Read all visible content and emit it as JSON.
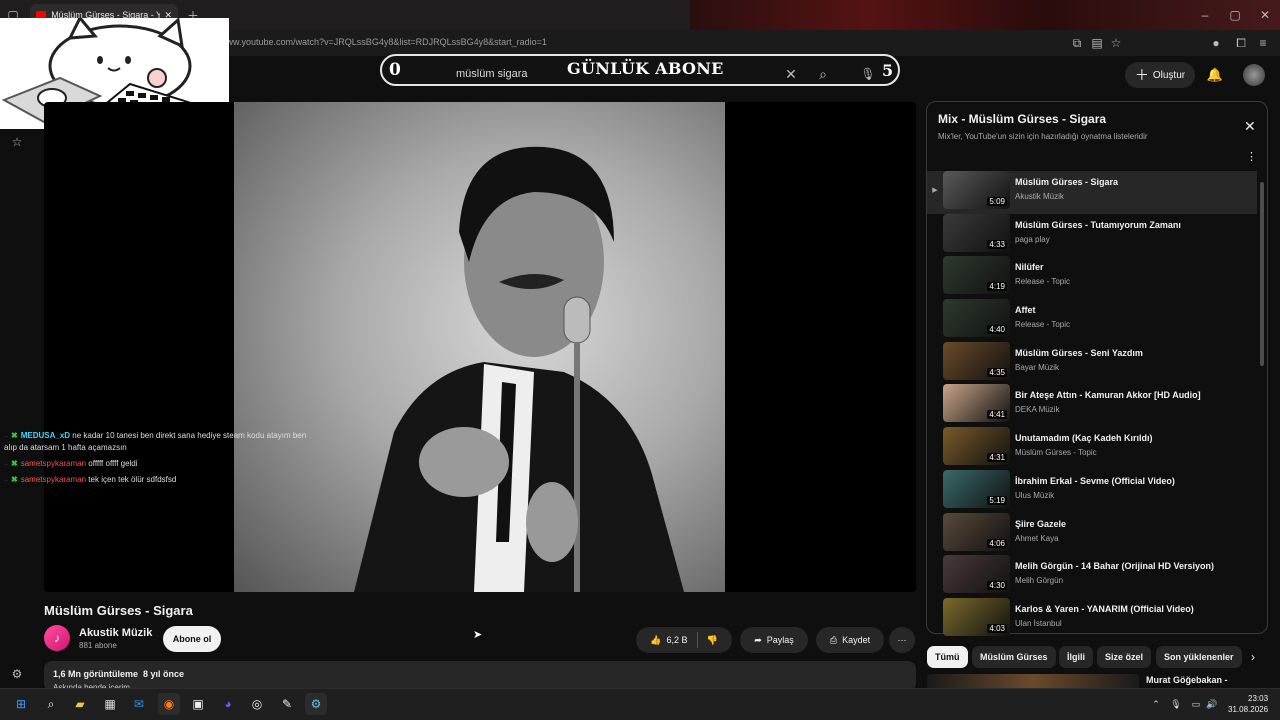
{
  "browser": {
    "tab_title": "Müslüm Gürses - Sigara - YouTube",
    "url": "www.youtube.com/watch?v=JRQLssBG4y8&list=RDJRQLssBG4y8&start_radio=1"
  },
  "overlay": {
    "sub_goal_left": "0",
    "sub_goal_label": "GÜNLÜK ABONE",
    "sub_goal_count": "5"
  },
  "header": {
    "search_value": "müslüm sigara",
    "create_label": "Oluştur"
  },
  "chat": [
    {
      "user": "MEDUSA_xD",
      "message": "ne kadar 10 tanesi ben direkt sana hediye steam kodu atayım ben"
    },
    {
      "continuation": "alıp da atarsam 1 hafta açamazsın"
    },
    {
      "user": "sametspykaraman",
      "message": "offfff offff geldi"
    },
    {
      "user": "sametspykaraman",
      "message": "tek içen tek ölür sdfdsfsd"
    }
  ],
  "video": {
    "title": "Müslüm Gürses - Sigara",
    "channel": "Akustik Müzik",
    "subscribers": "881 abone",
    "subscribe_label": "Abone ol",
    "likes": "6,2 B",
    "share_label": "Paylaş",
    "save_label": "Kaydet",
    "views": "1,6 Mn görüntüleme",
    "age": "8 yıl önce",
    "description_partial": "Aşkında bende içerim"
  },
  "playlist": {
    "title": "Mix - Müslüm Gürses - Sigara",
    "subtitle": "Mix'ler, YouTube'un sizin için hazırladığı oynatma listeleridir",
    "items": [
      {
        "title": "Müslüm Gürses - Sigara",
        "channel": "Akustik Müzik",
        "duration": "5:09",
        "active": true,
        "color": "#5a5a5a"
      },
      {
        "title": "Müslüm Gürses - Tutamıyorum Zamanı",
        "channel": "paga play",
        "duration": "4:33",
        "color": "#3a3a3a"
      },
      {
        "title": "Nilüfer",
        "channel": "Release - Topic",
        "duration": "4:19",
        "color": "#2e3a2e"
      },
      {
        "title": "Affet",
        "channel": "Release - Topic",
        "duration": "4:40",
        "color": "#2e3a2e"
      },
      {
        "title": "Müslüm Gürses - Seni Yazdım",
        "channel": "Bayar Müzik",
        "duration": "4:35",
        "color": "#6b4b2a"
      },
      {
        "title": "Bir Ateşe Attın - Kamuran Akkor [HD Audio]",
        "channel": "DEKA Müzik",
        "duration": "4:41",
        "color": "#c9a58a"
      },
      {
        "title": "Unutamadım (Kaç Kadeh Kırıldı)",
        "channel": "Müslüm Gürses - Topic",
        "duration": "4:31",
        "color": "#7a5a2a"
      },
      {
        "title": "İbrahim Erkal - Sevme (Official Video)",
        "channel": "Ulus Müzik",
        "duration": "5:19",
        "color": "#3a6a6a"
      },
      {
        "title": "Şiire Gazele",
        "channel": "Ahmet Kaya",
        "duration": "4:06",
        "color": "#5a4a3a"
      },
      {
        "title": "Melih Görgün - 14 Bahar (Orijinal HD Versiyon)",
        "channel": "Melih Görgün",
        "duration": "4:30",
        "color": "#4a3a3a"
      },
      {
        "title": "Karlos & Yaren - YANARIM (Official Video)",
        "channel": "Ulan İstanbul",
        "duration": "4:03",
        "color": "#7a6a2a"
      }
    ]
  },
  "chips": [
    "Tümü",
    "Müslüm Gürses",
    "İlgili",
    "Size özel",
    "Son yüklenenler"
  ],
  "next_video": {
    "title": "Murat Göğebakan -"
  },
  "taskbar": {
    "time": "23:03",
    "date": "31.08.2026"
  }
}
